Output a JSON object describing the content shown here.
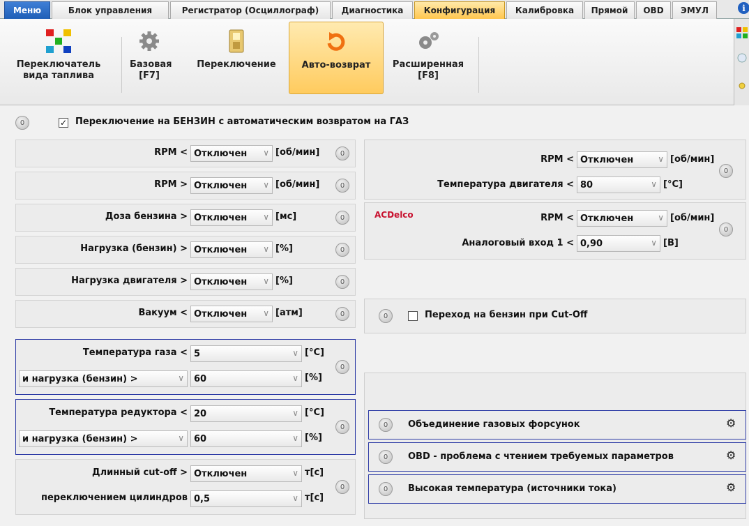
{
  "tabs": [
    {
      "label": "Меню",
      "kind": "menu"
    },
    {
      "label": "Блок управления"
    },
    {
      "label": "Регистратор (Осциллограф)"
    },
    {
      "label": "Диагностика"
    },
    {
      "label": "Конфигурация",
      "kind": "active"
    },
    {
      "label": "Калибровка"
    },
    {
      "label": "Прямой"
    },
    {
      "label": "OBD"
    },
    {
      "label": "ЭМУЛ"
    }
  ],
  "ribbon": {
    "fuel_switch": "Переключатель вида таплива",
    "base": "Базовая [F7]",
    "switching": "Переключение",
    "auto_return": "Авто-возврат",
    "extended": "Расширенная [F8]"
  },
  "main": {
    "pin": "0",
    "header_check": "✓",
    "header_label": "Переключение на БЕНЗИН с автоматическим возвратом на ГАЗ"
  },
  "left_rows": [
    {
      "label": "RPM <",
      "value": "Отключен",
      "unit": "[об/мин]"
    },
    {
      "label": "RPM >",
      "value": "Отключен",
      "unit": "[об/мин]"
    },
    {
      "label": "Доза бензина >",
      "value": "Отключен",
      "unit": "[мс]"
    },
    {
      "label": "Нагрузка (бензин) >",
      "value": "Отключен",
      "unit": "[%]"
    },
    {
      "label": "Нагрузка двигателя >",
      "value": "Отключен",
      "unit": "[%]"
    },
    {
      "label": "Вакуум <",
      "value": "Отключен",
      "unit": "[атм]"
    }
  ],
  "groups": {
    "gas_temp": {
      "label": "Температура газа <",
      "value": "5",
      "unit": "[°C]",
      "sub_label": "и нагрузка (бензин) >",
      "sub_value": "60",
      "sub_unit": "[%]"
    },
    "reducer_temp": {
      "label": "Температура редуктора <",
      "value": "20",
      "unit": "[°C]",
      "sub_label": "и нагрузка (бензин) >",
      "sub_value": "60",
      "sub_unit": "[%]"
    },
    "cutoff": {
      "label": "Длинный cut-off >",
      "value": "Отключен",
      "unit": "т[с]",
      "sub_label": "переключением цилиндров",
      "sub_value": "0,5",
      "sub_unit": "т[с]"
    }
  },
  "right": {
    "panel1": {
      "rpm_label": "RPM <",
      "rpm_value": "Отключен",
      "rpm_unit": "[об/мин]",
      "temp_label": "Температура двигателя <",
      "temp_value": "80",
      "temp_unit": "[°C]"
    },
    "panel2": {
      "brand": "ACDelco",
      "rpm_label": "RPM <",
      "rpm_value": "Отключен",
      "rpm_unit": "[об/мин]",
      "in_label": "Аналоговый вход 1 <",
      "in_value": "0,90",
      "in_unit": "[В]"
    },
    "cutoff_label": "Переход на бензин при Cut-Off",
    "items": [
      {
        "label": "Объединение газовых форсунок"
      },
      {
        "label": "OBD - проблема с чтением требуемых параметров"
      },
      {
        "label": "Высокая температура (источники тока)"
      }
    ]
  },
  "colors": {
    "accent_border": "#2c3aa5",
    "brand_red": "#c8102e",
    "active_tab": "#ffc64f"
  }
}
